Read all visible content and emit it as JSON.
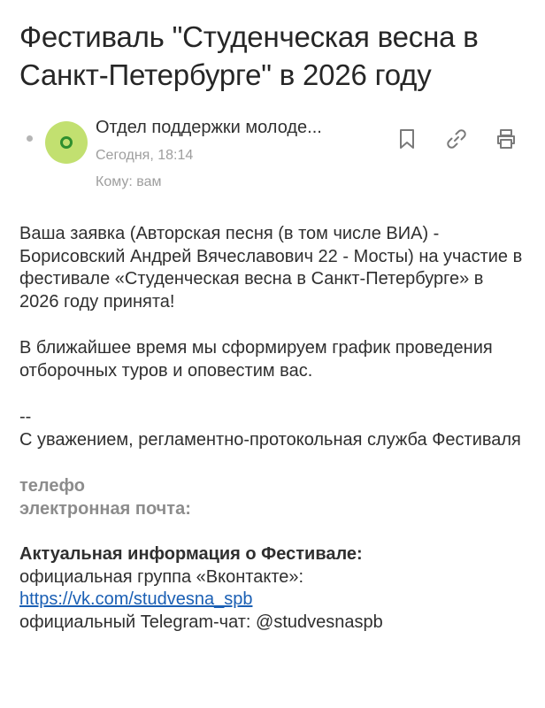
{
  "email": {
    "subject": "Фестиваль \"Студенческая весна в Санкт-Петербурге\" в 2026 году",
    "sender": "Отдел поддержки молоде...",
    "avatar_letter": "o",
    "date": "Сегодня, 18:14",
    "recipient_prefix": "Кому:",
    "recipient": "вам"
  },
  "actions": {
    "icons": [
      "bookmark-icon",
      "link-icon",
      "print-icon"
    ]
  },
  "body": {
    "paragraph1": "Ваша заявка (Авторская песня (в том числе ВИА) - Борисовский Андрей Вячеславович 22 - Мосты) на участие в фестивале «Студенческая весна в Санкт-Петербурге» в 2026 году принята!",
    "paragraph2": "В ближайшее время мы сформируем график проведения отборочных туров и оповестим вас.",
    "separator": "--",
    "signature": "С уважением, регламентно-протокольная служба Фестиваля",
    "phone_label": "телефо",
    "email_label": "электронная почта:",
    "info_heading": "Актуальная информация о Фестивале:",
    "vk_label": "официальная группа «Вконтакте»:",
    "vk_link": "https://vk.com/studvesna_spb",
    "telegram": "официальный Telegram-чат: @studvesnaspb"
  },
  "colors": {
    "accent_link": "#1a5fb4",
    "avatar_bg": "#c2e070",
    "avatar_ring": "#2e8f2e",
    "muted_text": "#9e9e9e"
  }
}
